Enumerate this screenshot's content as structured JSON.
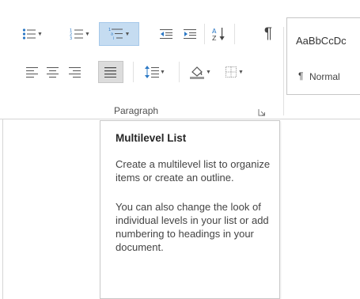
{
  "ribbon": {
    "group_label": "Paragraph",
    "row1": [
      {
        "name": "bullets",
        "icon": "bullet-list-icon",
        "has_dropdown": true
      },
      {
        "name": "numbering",
        "icon": "numbered-list-icon",
        "has_dropdown": true
      },
      {
        "name": "multilevel-list",
        "icon": "multilevel-list-icon",
        "has_dropdown": true,
        "state": "hover"
      },
      {
        "name": "decrease-indent",
        "icon": "decrease-indent-icon"
      },
      {
        "name": "increase-indent",
        "icon": "increase-indent-icon"
      },
      {
        "name": "sort",
        "icon": "sort-az-icon"
      },
      {
        "name": "show-hide",
        "icon": "pilcrow-icon",
        "glyph": "¶"
      }
    ],
    "row2": [
      {
        "name": "align-left",
        "icon": "align-left-icon"
      },
      {
        "name": "center",
        "icon": "align-center-icon"
      },
      {
        "name": "align-right",
        "icon": "align-right-icon"
      },
      {
        "name": "justify",
        "icon": "justify-icon",
        "state": "pressed"
      },
      {
        "name": "line-spacing",
        "icon": "line-spacing-icon",
        "has_dropdown": true
      },
      {
        "name": "shading",
        "icon": "paint-bucket-icon",
        "has_dropdown": true
      },
      {
        "name": "borders",
        "icon": "borders-icon",
        "has_dropdown": true
      }
    ]
  },
  "styles": {
    "sample": "AaBbCcDc",
    "pilcrow": "¶",
    "name": "Normal"
  },
  "tooltip": {
    "title": "Multilevel List",
    "paragraph1": "Create a multilevel list to organize items or create an outline.",
    "paragraph2": "You can also change the look of individual levels in your list or add numbering to headings in your document."
  },
  "colors": {
    "hover_bg": "#c5dcf1",
    "hover_border": "#a5c8e9",
    "pressed_bg": "#dcdcdc",
    "accent_blue": "#2b78c5"
  }
}
